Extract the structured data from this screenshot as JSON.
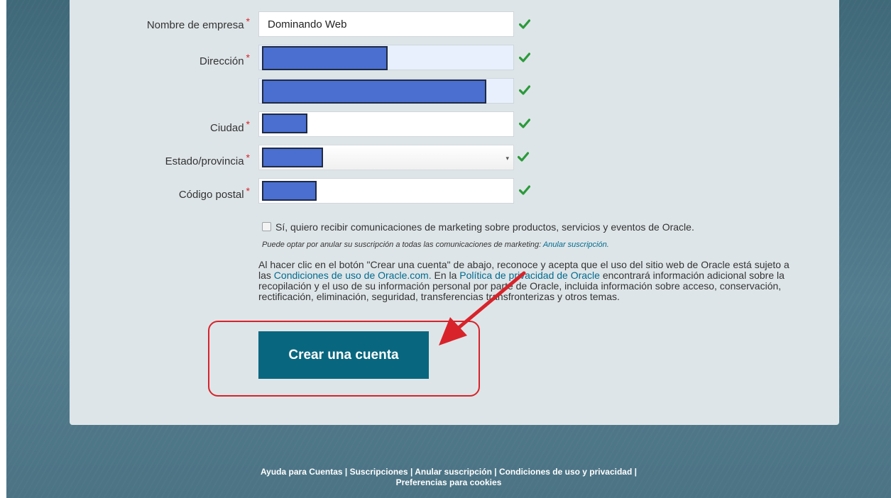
{
  "form": {
    "required_mark": "*",
    "company": {
      "label": "Nombre de empresa",
      "value": "Dominando Web"
    },
    "address": {
      "label": "Dirección"
    },
    "city": {
      "label": "Ciudad"
    },
    "state": {
      "label": "Estado/provincia",
      "caret": "▾"
    },
    "postal": {
      "label": "Código postal"
    },
    "valid_icon": "check-icon",
    "redaction_color": "#4a6fd0"
  },
  "marketing": {
    "optin_label": "Sí, quiero recibir comunicaciones de marketing sobre productos, servicios y eventos de Oracle.",
    "note_text": "Puede optar por anular su suscripción a todas las comunicaciones de marketing:",
    "note_link": "Anular suscripción."
  },
  "legal": {
    "part1": "Al hacer clic en el botón \"Crear una cuenta\" de abajo, reconoce y acepta que el uso del sitio web de Oracle está sujeto a las",
    "terms_link": "Condiciones de uso de Oracle.com.",
    "part2": "En la",
    "privacy_link": "Política de privacidad de Oracle",
    "part3": "encontrará información adicional sobre la recopilación y el uso de su información personal por parte de Oracle, incluida información sobre acceso, conservación, rectificación, eliminación, seguridad, transferencias transfronterizas y otros temas."
  },
  "submit_label": "Crear una cuenta",
  "annotation_color": "#d8232a",
  "footer": {
    "links": [
      "Ayuda para Cuentas",
      "Suscripciones",
      "Anular suscripción",
      "Condiciones de uso y privacidad",
      "Preferencias para cookies"
    ],
    "separator": " | "
  }
}
